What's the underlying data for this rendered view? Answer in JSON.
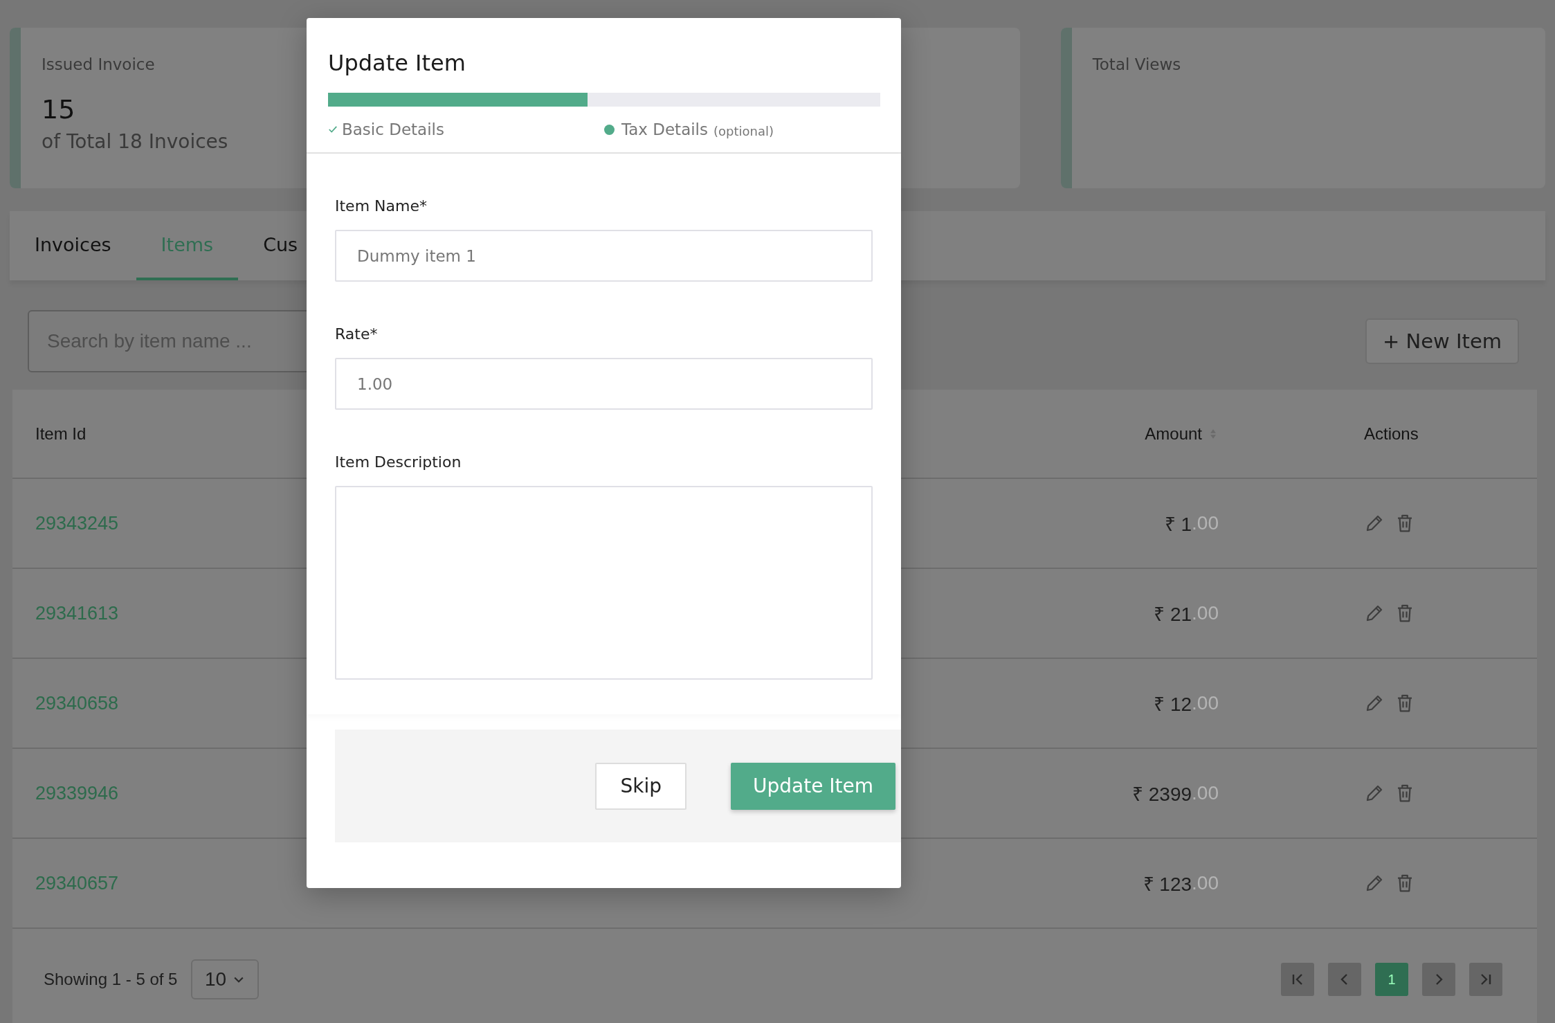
{
  "cards": [
    {
      "kind": "stat",
      "label": "Issued Invoice",
      "value": "15",
      "sub": "of Total 18 Invoices"
    },
    {
      "kind": "blank"
    },
    {
      "kind": "stat",
      "label": "Total Views"
    }
  ],
  "tabs": [
    {
      "label": "Invoices",
      "selected": false
    },
    {
      "label": "Items",
      "selected": true
    },
    {
      "label": "Cus",
      "selected": false
    }
  ],
  "search": {
    "placeholder": "Search by item name ..."
  },
  "new_button": {
    "label": "+ New Item"
  },
  "table": {
    "columns": [
      {
        "label": "Item Id",
        "sortable": false
      },
      {
        "label": "Amount",
        "sortable": true
      },
      {
        "label": "Actions",
        "sortable": false
      }
    ],
    "rows": [
      {
        "item_id": "29343245",
        "amount": "₹ 1",
        "fraction": ".00"
      },
      {
        "item_id": "29341613",
        "amount": "₹ 21",
        "fraction": ".00"
      },
      {
        "item_id": "29340658",
        "amount": "₹ 12",
        "fraction": ".00"
      },
      {
        "item_id": "29339946",
        "amount": "₹ 2399",
        "fraction": ".00"
      },
      {
        "item_id": "29340657",
        "amount": "₹ 123",
        "fraction": ".00"
      }
    ]
  },
  "footer": {
    "showing": "Showing 1 - 5 of 5",
    "page_size": "10",
    "pages": [
      {
        "kind": "first"
      },
      {
        "kind": "prev"
      },
      {
        "kind": "page",
        "label": "1",
        "selected": true
      },
      {
        "kind": "next"
      },
      {
        "kind": "last"
      }
    ]
  },
  "modal": {
    "title": "Update Item",
    "progress": {
      "level": 0.47
    },
    "steps": [
      {
        "label": "Basic Details",
        "done": true
      },
      {
        "label": "Tax Details",
        "hint": "(optional)",
        "done": false
      }
    ],
    "fields": [
      {
        "kind": "input",
        "label": "Item Name*",
        "value": "Dummy item 1"
      },
      {
        "kind": "input",
        "label": "Rate*",
        "value": "1.00"
      },
      {
        "kind": "textarea",
        "label": "Item Description"
      }
    ],
    "buttons": [
      {
        "kind": "secondary",
        "label": "Skip"
      },
      {
        "kind": "primary",
        "label": "Update Item"
      }
    ]
  }
}
